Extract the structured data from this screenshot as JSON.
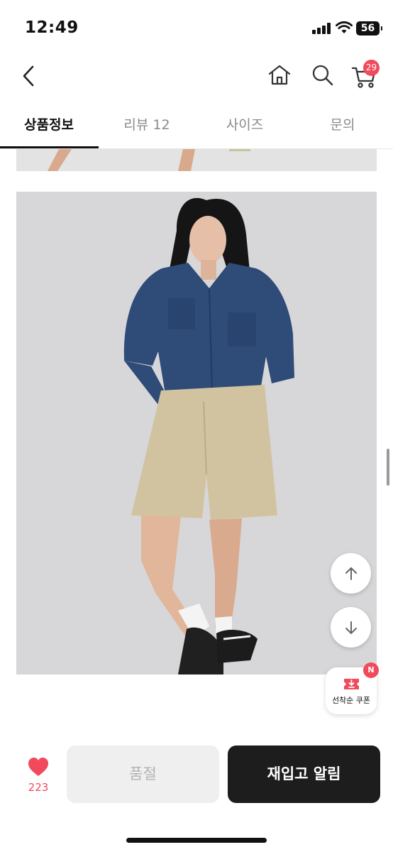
{
  "status_bar": {
    "time": "12:49",
    "battery": "56"
  },
  "header": {
    "back_icon": "chevron-left-icon",
    "home_icon": "home-icon",
    "search_icon": "search-icon",
    "cart_icon": "cart-icon",
    "cart_count": "29"
  },
  "tabs": [
    {
      "label": "상품정보",
      "active": true
    },
    {
      "label": "리뷰 12",
      "active": false
    },
    {
      "label": "사이즈",
      "active": false
    },
    {
      "label": "문의",
      "active": false
    }
  ],
  "floating": {
    "scroll_up_icon": "arrow-up-icon",
    "scroll_down_icon": "arrow-down-icon",
    "coupon_label": "선착순 쿠폰",
    "coupon_badge": "N"
  },
  "bottom_bar": {
    "wish_icon": "heart-icon",
    "wish_count": "223",
    "soldout_label": "품절",
    "restock_label": "재입고 알림"
  },
  "colors": {
    "accent": "#f04a5c",
    "primary_button": "#1d1d1d",
    "disabled_button": "#efefef"
  }
}
